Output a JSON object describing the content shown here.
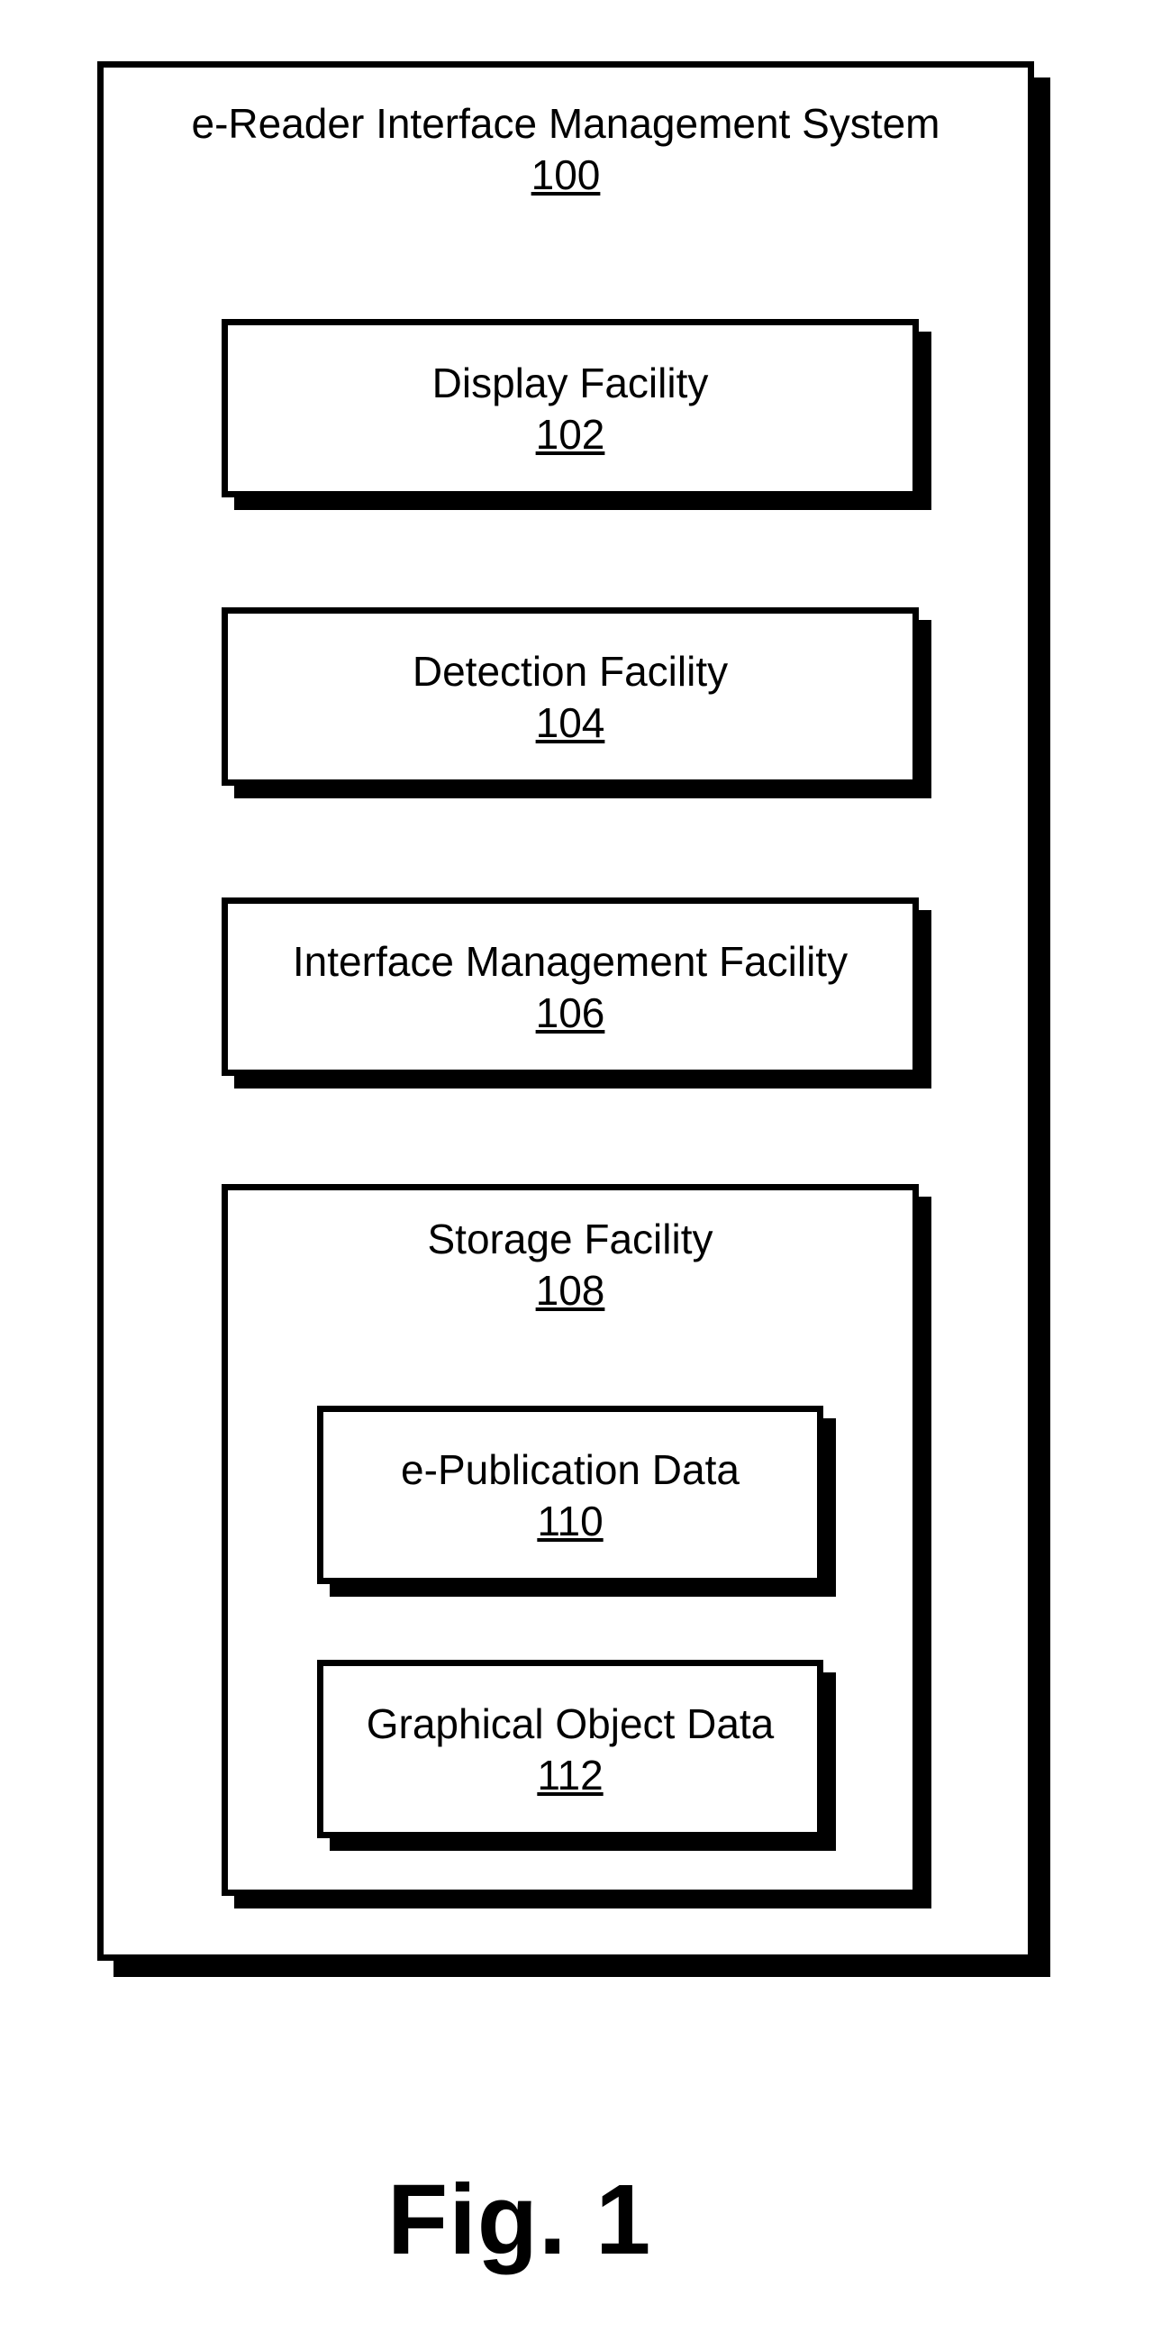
{
  "figure": {
    "caption": "Fig. 1"
  },
  "system": {
    "title": "e-Reader Interface Management System",
    "ref": "100",
    "blocks": {
      "display": {
        "title": "Display Facility",
        "ref": "102"
      },
      "detection": {
        "title": "Detection Facility",
        "ref": "104"
      },
      "ifmgmt": {
        "title": "Interface Management Facility",
        "ref": "106"
      },
      "storage": {
        "title": "Storage Facility",
        "ref": "108",
        "children": {
          "epub": {
            "title": "e-Publication Data",
            "ref": "110"
          },
          "gobj": {
            "title": "Graphical Object Data",
            "ref": "112"
          }
        }
      }
    }
  }
}
